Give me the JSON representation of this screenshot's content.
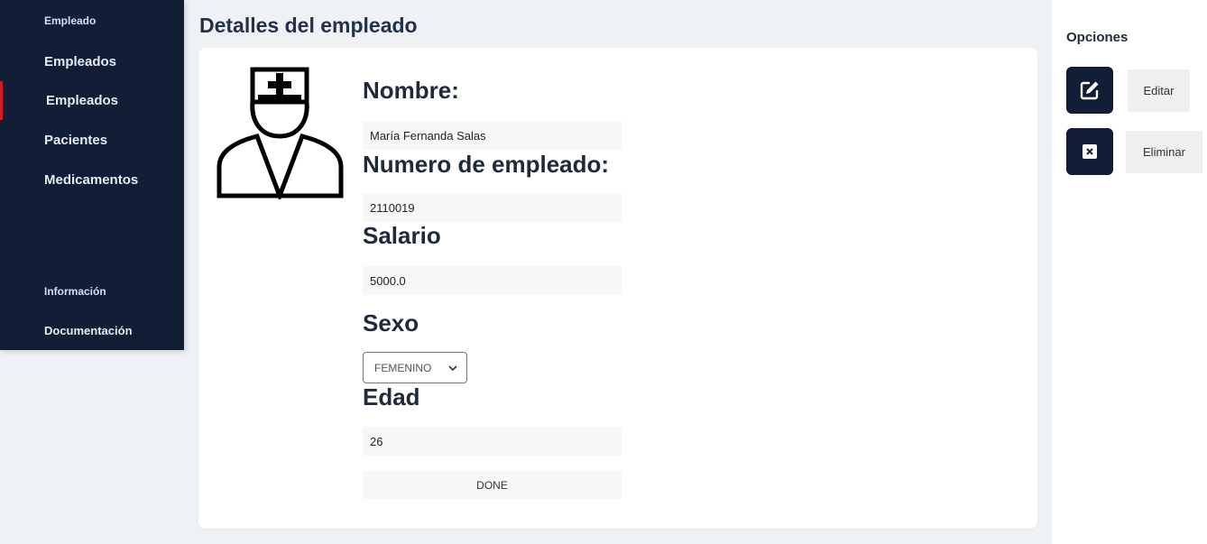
{
  "sidebar": {
    "section_empleado": "Empleado",
    "items": [
      {
        "label": "Empleados"
      },
      {
        "label": "Empleados"
      },
      {
        "label": "Pacientes"
      },
      {
        "label": "Medicamentos"
      }
    ],
    "section_info": "Información",
    "documentation": "Documentación"
  },
  "main": {
    "title": "Detalles del empleado",
    "fields": {
      "nombre_label": "Nombre:",
      "nombre_value": "María Fernanda Salas",
      "numero_label": "Numero de empleado:",
      "numero_value": "2110019",
      "salario_label": "Salario",
      "salario_value": "5000.0",
      "sexo_label": "Sexo",
      "sexo_value": "FEMENINO",
      "edad_label": "Edad",
      "edad_value": "26"
    },
    "done_label": "DONE"
  },
  "options": {
    "title": "Opciones",
    "edit_label": "Editar",
    "delete_label": "Eliminar"
  },
  "icons": {
    "avatar": "nurse-avatar-icon",
    "edit": "edit-icon",
    "delete": "delete-icon",
    "select_arrow": "chevron-down-icon"
  },
  "colors": {
    "sidebar_bg": "#111e36",
    "active_indicator": "#d11a2a",
    "page_bg": "#eef2f5"
  }
}
